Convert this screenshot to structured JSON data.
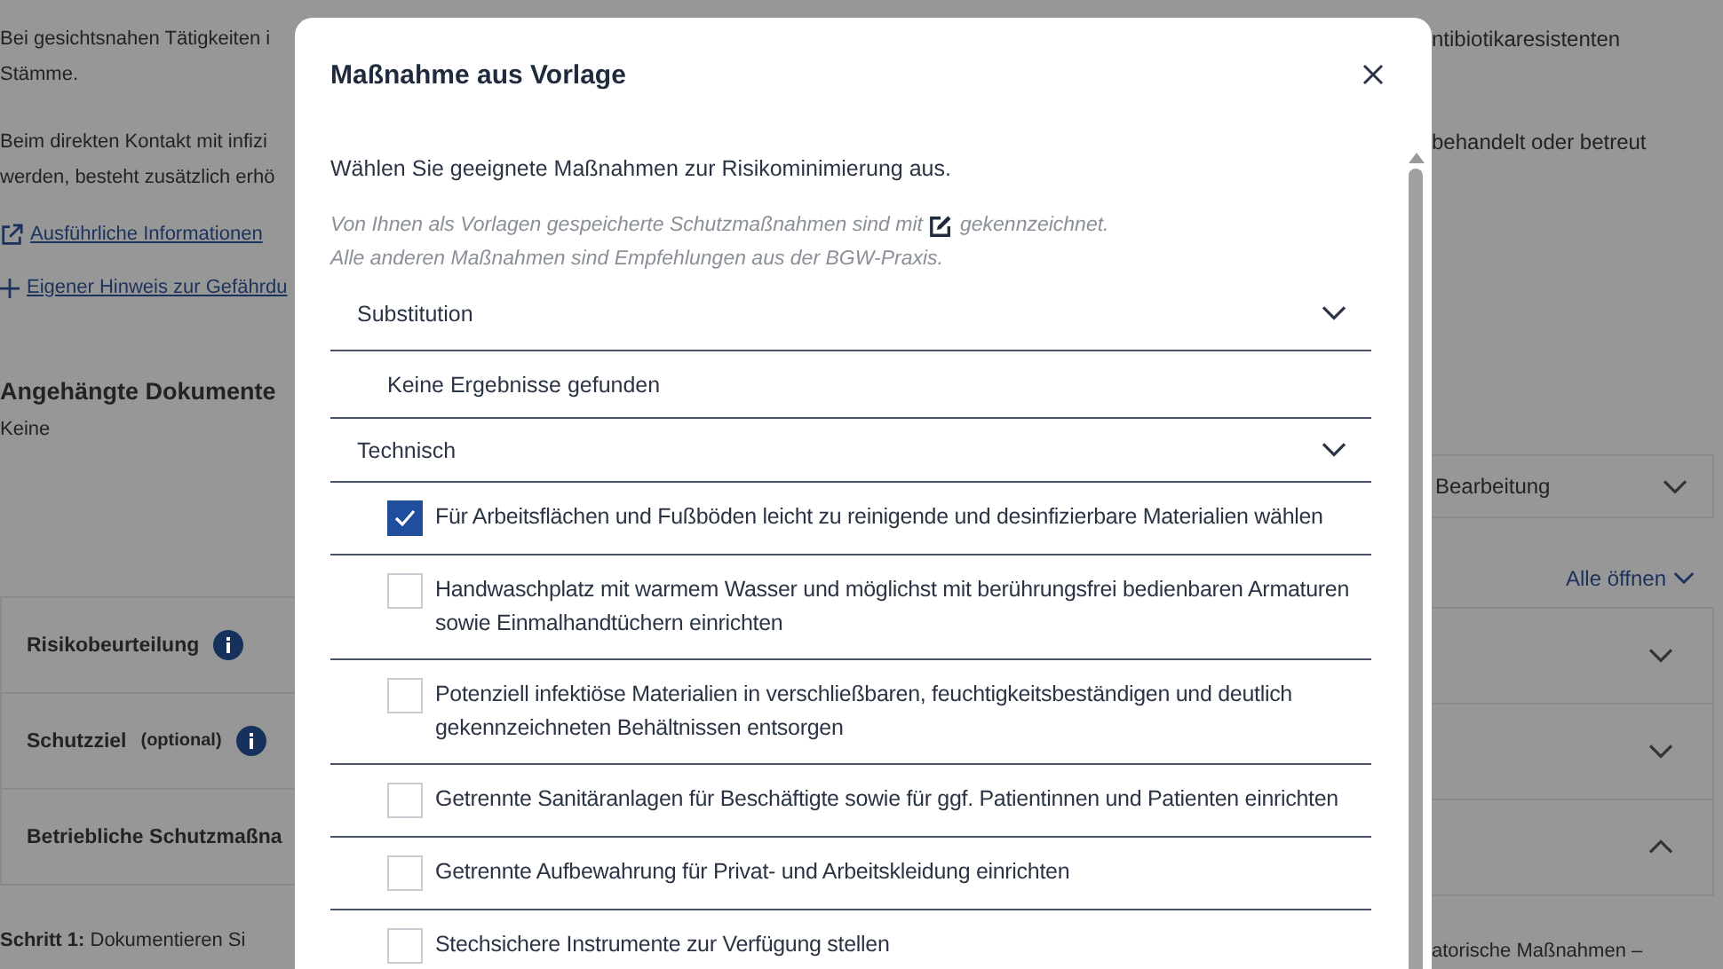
{
  "page": {
    "left": {
      "paragraph_1": [
        "Bei gesichtsnahen Tätigkeiten i",
        "Stämme."
      ],
      "paragraph_2": [
        "Beim direkten Kontakt mit infizi",
        "werden, besteht zusätzlich erhö"
      ],
      "info_link": "Ausführliche Informationen",
      "add_link": "Eigener Hinweis zur Gefährdu",
      "documents_heading": "Angehängte Dokumente",
      "documents_value": "Keine"
    },
    "right": {
      "paragraph_1": "ntibiotikaresistenten",
      "paragraph_2": "behandelt oder betreut",
      "status_select": "Bearbeitung",
      "expand_all": "Alle öffnen"
    },
    "sections": [
      {
        "title": "Risikobeurteilung",
        "info": true,
        "expanded": false
      },
      {
        "title": "Schutzziel",
        "note": "(optional)",
        "info": true,
        "expanded": false
      },
      {
        "title": "Betriebliche Schutzmaßna",
        "info": false,
        "expanded": true
      }
    ],
    "step": {
      "text_left": "**Schritt 1:** Dokumentieren Si",
      "text_right": "atorische Maßnahmen –"
    }
  },
  "modal": {
    "title": "Maßnahme aus Vorlage",
    "intro": "Wählen Sie geeignete Maßnahmen zur Risikominimierung aus.",
    "hint": {
      "before_icon": "Von Ihnen als Vorlagen gespeicherte Schutzmaßnahmen sind mit",
      "after_icon": "gekennzeichnet.",
      "second_line": "Alle anderen Maßnahmen sind Empfehlungen aus der BGW-Praxis."
    },
    "groups": [
      {
        "title": "Substitution",
        "empty_message": "Keine Ergebnisse gefunden"
      },
      {
        "title": "Technisch",
        "items": [
          {
            "label": "Für Arbeitsflächen und Fußböden leicht zu reinigende und desinfizierbare Materialien wählen",
            "checked": true
          },
          {
            "label": "Handwaschplatz mit warmem Wasser und möglichst mit berührungsfrei bedienbaren Armaturen sowie Einmalhandtüchern einrichten",
            "checked": false
          },
          {
            "label": "Potenziell infektiöse Materialien in verschließbaren, feuchtigkeitsbeständigen und deutlich gekennzeichneten Behältnissen entsorgen",
            "checked": false
          },
          {
            "label": "Getrennte Sanitäranlagen für Beschäftigte sowie für ggf. Patientinnen und Patienten einrichten",
            "checked": false
          },
          {
            "label": "Getrennte Aufbewahrung für Privat- und Arbeitskleidung einrichten",
            "checked": false
          },
          {
            "label": "Stechsichere Instrumente zur Verfügung stellen",
            "checked": false
          }
        ]
      }
    ]
  }
}
